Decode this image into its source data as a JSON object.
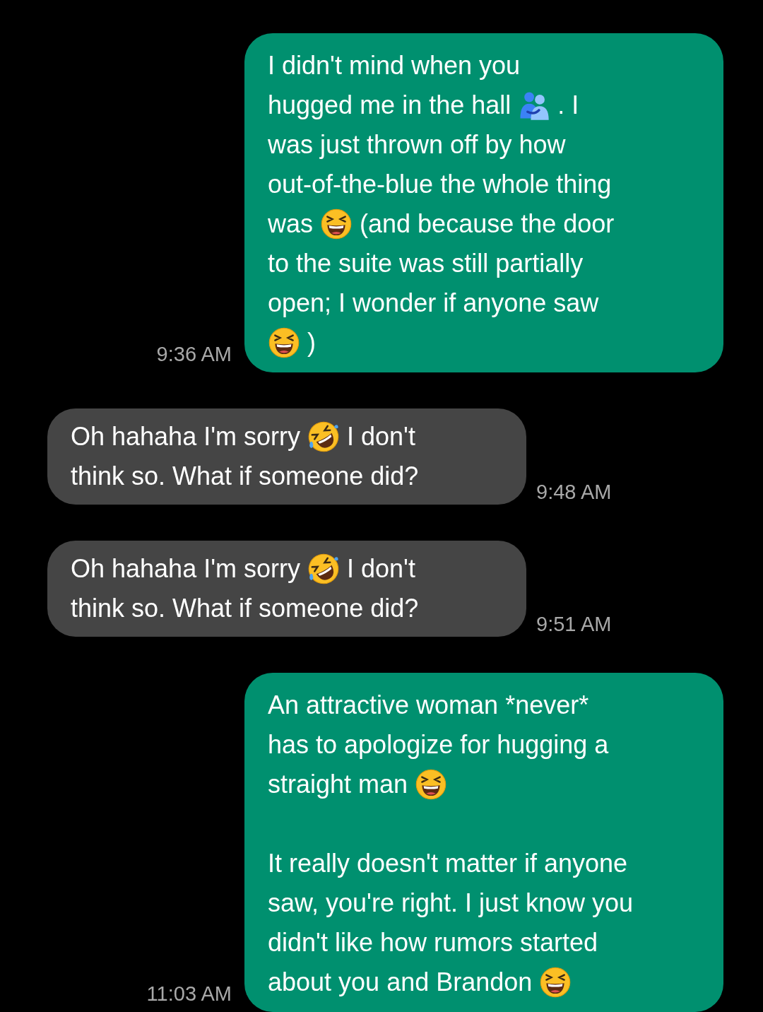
{
  "messages": [
    {
      "kind": "sent",
      "time": "9:36 AM",
      "paragraphs": [
        [
          [
            {
              "kind": "text",
              "text": "I didn't mind when you"
            }
          ],
          [
            {
              "kind": "text",
              "text": "hugged me in the hall"
            },
            {
              "kind": "hug"
            },
            {
              "kind": "text",
              "text": ". I"
            }
          ],
          [
            {
              "kind": "text",
              "text": "was just thrown off by how"
            }
          ],
          [
            {
              "kind": "text",
              "text": "out-of-the-blue the whole thing"
            }
          ],
          [
            {
              "kind": "text",
              "text": "was"
            },
            {
              "kind": "squint"
            },
            {
              "kind": "text",
              "text": "(and because the door"
            }
          ],
          [
            {
              "kind": "text",
              "text": "to the suite was still partially"
            }
          ],
          [
            {
              "kind": "text",
              "text": "open; I wonder if anyone saw"
            }
          ],
          [
            {
              "kind": "squint"
            },
            {
              "kind": "text",
              "text": ")"
            }
          ]
        ]
      ]
    },
    {
      "kind": "received",
      "time": "9:48 AM",
      "paragraphs": [
        [
          [
            {
              "kind": "text",
              "text": "Oh hahaha I'm sorry"
            },
            {
              "kind": "rofl"
            },
            {
              "kind": "text",
              "text": "I don't"
            }
          ],
          [
            {
              "kind": "text",
              "text": "think so. What if someone did?"
            }
          ]
        ]
      ]
    },
    {
      "kind": "received",
      "time": "9:51 AM",
      "paragraphs": [
        [
          [
            {
              "kind": "text",
              "text": "Oh hahaha I'm sorry"
            },
            {
              "kind": "rofl"
            },
            {
              "kind": "text",
              "text": "I don't"
            }
          ],
          [
            {
              "kind": "text",
              "text": "think so. What if someone did?"
            }
          ]
        ]
      ]
    },
    {
      "kind": "sent",
      "time": "11:03 AM",
      "paragraphs": [
        [
          [
            {
              "kind": "text",
              "text": "An attractive woman *never*"
            }
          ],
          [
            {
              "kind": "text",
              "text": "has to apologize for hugging a"
            }
          ],
          [
            {
              "kind": "text",
              "text": "straight man"
            },
            {
              "kind": "squint"
            }
          ]
        ],
        [
          [
            {
              "kind": "text",
              "text": "It really doesn't matter if anyone"
            }
          ],
          [
            {
              "kind": "text",
              "text": "saw, you're right. I just know you"
            }
          ],
          [
            {
              "kind": "text",
              "text": "didn't like how rumors started"
            }
          ],
          [
            {
              "kind": "text",
              "text": "about you and Brandon"
            },
            {
              "kind": "squint"
            }
          ]
        ]
      ]
    }
  ]
}
